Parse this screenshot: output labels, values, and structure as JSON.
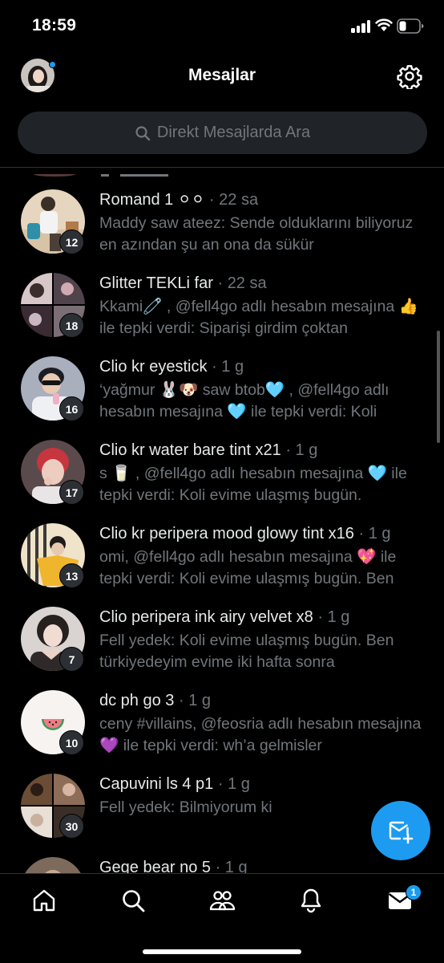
{
  "status_bar": {
    "time": "18:59",
    "battery_level": 0.3
  },
  "header": {
    "title": "Mesajlar",
    "avatar_icon": "profile-avatar",
    "settings_icon": "gear-icon"
  },
  "search": {
    "placeholder": "Direkt Mesajlarda Ara"
  },
  "conversations": [
    {
      "name": "Romand 1 ⚪⚪",
      "time": "22 sa",
      "message": "Maddy saw ateez: Sende olduklarını biliyoruz en azından şu an ona da sükür",
      "unread": "12",
      "avatar_color": "#cfa274"
    },
    {
      "name": "Glitter TEKLi far",
      "time": "22 sa",
      "message": "Kkami🧷 , @fell4go adlı hesabın mesajına 👍 ile tepki verdi: Siparişi girdim çoktan",
      "unread": "18",
      "avatar_color": "#6b5a66"
    },
    {
      "name": "Clio kr eyestick",
      "time": "1 g",
      "message": "‘yağmur 🐰🐶 saw btob🩵 , @fell4go adlı hesabın mesajına 🩵 ile tepki verdi: Koli",
      "unread": "16",
      "avatar_color": "#8a8f9c"
    },
    {
      "name": "Clio kr water bare tint x21",
      "time": "1 g",
      "message": "s 🥛 , @fell4go adlı hesabın mesajına 🩵 ile tepki verdi: Koli evime ulaşmış bugün.",
      "unread": "17",
      "avatar_color": "#b4454e"
    },
    {
      "name": "Clio kr peripera mood glowy tint x16",
      "time": "1 g",
      "message": "omi, @fell4go adlı hesabın mesajına 💖 ile tepki verdi: Koli evime ulaşmış bugün. Ben",
      "unread": "13",
      "avatar_color": "#e6b33a"
    },
    {
      "name": "Clio peripera ink airy velvet x8",
      "time": "1 g",
      "message": "Fell yedek: Koli evime ulaşmış bugün. Ben türkiyedeyim evime iki hafta sonra",
      "unread": "7",
      "avatar_color": "#5c5857"
    },
    {
      "name": "dc ph go 3",
      "time": "1 g",
      "message": "ceny #villains, @feosria adlı hesabın mesajına 💜 ile tepki verdi: wh’a gelmisler",
      "unread": "10",
      "avatar_color": "#f4f1ef"
    },
    {
      "name": "Capuvini ls 4 p1",
      "time": "1 g",
      "message": "Fell yedek: Bilmiyorum ki",
      "unread": "30",
      "avatar_color": "#5e4a3a"
    },
    {
      "name": "Gege bear no 5",
      "time": "1 g",
      "message": "",
      "unread": "",
      "avatar_color": "#7d6a5c"
    }
  ],
  "fab": {
    "icon": "new-message-icon"
  },
  "tab_bar": {
    "items": [
      {
        "name": "home-icon"
      },
      {
        "name": "search-icon"
      },
      {
        "name": "communities-icon"
      },
      {
        "name": "notifications-icon"
      },
      {
        "name": "messages-icon"
      }
    ],
    "messages_badge": "1"
  },
  "colors": {
    "accent": "#1d9bf0",
    "background": "#000000",
    "secondary_text": "#71767b"
  }
}
